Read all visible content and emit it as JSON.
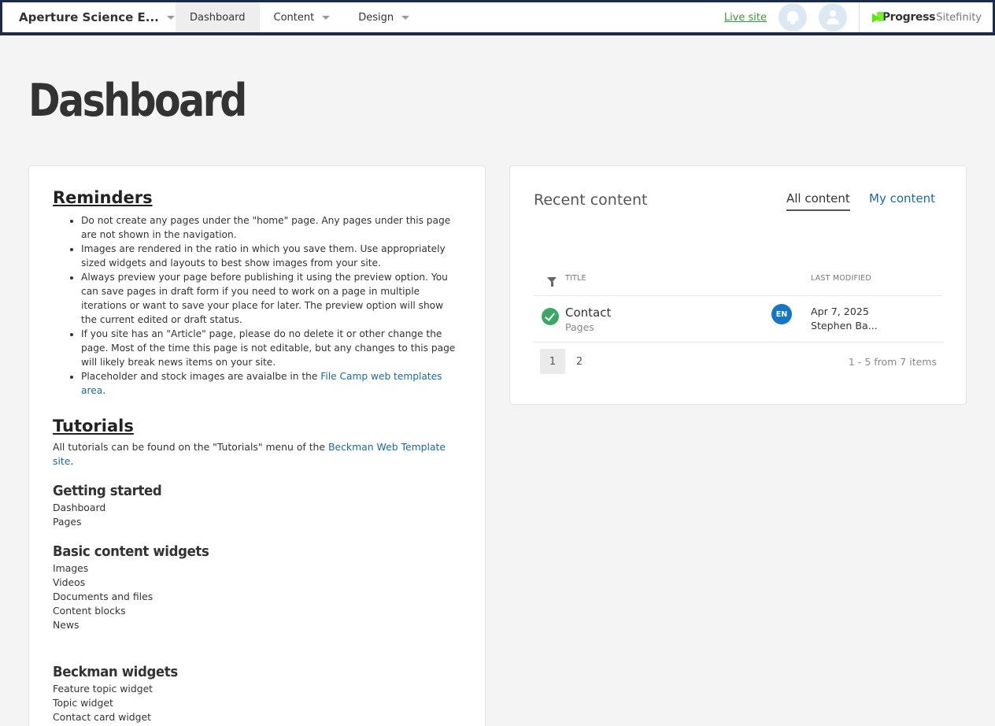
{
  "topbar": {
    "site_name": "Aperture Science E...",
    "nav": [
      "Dashboard",
      "Content",
      "Design"
    ],
    "live_site": "Live site",
    "brand": "Progress",
    "brand_product": "Sitefinity",
    "icons": [
      "globe-icon",
      "bell-icon",
      "user-icon",
      "progress-logo"
    ]
  },
  "page": {
    "title": "Dashboard"
  },
  "reminders": {
    "heading": "Reminders",
    "items": [
      "Do not create any pages under the \"home\" page. Any pages under this page are not shown in the navigation.",
      "Images are rendered in the ratio in which you save them. Use appropriately sized widgets and layouts to best show images from your site.",
      "Always preview your page before publishing it using the preview option. You can save pages in draft form if you need to work on a page in multiple iterations or want to save your place for later. The preview option will show the current edited or draft status.",
      "If you site has an \"Article\" page, please do no delete it or other change the page. Most of the time this page is not editable, but any changes to this page will likely break news items on your site."
    ],
    "last_item_prefix": "Placeholder and stock images are avaialbe in the ",
    "last_item_link": "File Camp web templates area",
    "last_item_suffix": "."
  },
  "tutorials": {
    "heading": "Tutorials",
    "intro_prefix": "All tutorials can be found on the \"Tutorials\" menu of the ",
    "intro_link": "Beckman Web Template site",
    "intro_suffix": ".",
    "groups": [
      {
        "title": "Getting started",
        "items": [
          "Dashboard",
          "Pages"
        ]
      },
      {
        "title": "Basic content widgets",
        "items": [
          "Images",
          "Videos",
          "Documents and files",
          "Content blocks",
          "News"
        ]
      },
      {
        "title": "Beckman widgets",
        "items": [
          "Feature topic widget",
          "Topic widget",
          "Contact card widget"
        ]
      }
    ]
  },
  "recent": {
    "title": "Recent content",
    "tabs": [
      "All content",
      "My content"
    ],
    "columns": [
      "TITLE",
      "LAST MODIFIED"
    ],
    "row": {
      "title": "Contact",
      "type": "Pages",
      "lang": "EN",
      "date": "Apr 7, 2025",
      "author": "Stephen Ba..."
    },
    "pages": [
      "1",
      "2"
    ],
    "summary": "1 - 5 from 7 items"
  }
}
